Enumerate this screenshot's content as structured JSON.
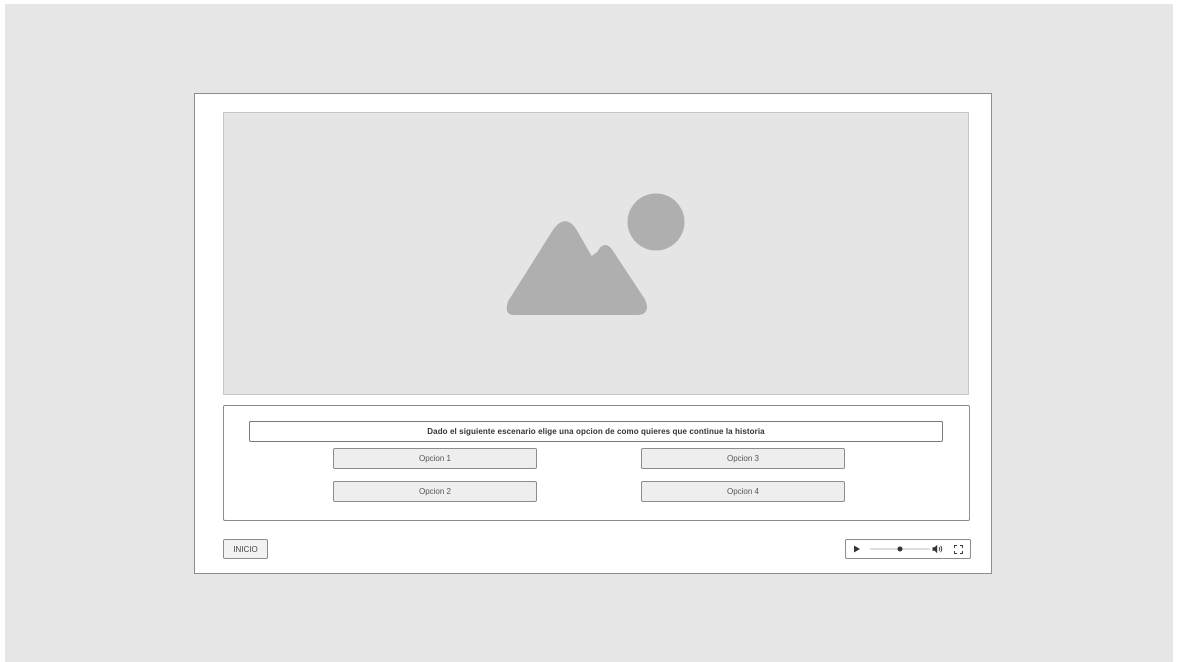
{
  "prompt": {
    "text": "Dado el siguiente escenario elige una opcion de como quieres que continue la historia"
  },
  "options": [
    {
      "label": "Opcion 1"
    },
    {
      "label": "Opcion 2"
    },
    {
      "label": "Opcion 3"
    },
    {
      "label": "Opcion 4"
    }
  ],
  "footer": {
    "start_label": "INICIO"
  },
  "player": {
    "progress": 0.5,
    "icons": {
      "play": "play-icon",
      "seek": "seek-slider",
      "volume": "volume-icon",
      "fullscreen": "fullscreen-icon"
    }
  },
  "image": {
    "icon": "image-placeholder-icon"
  },
  "colors": {
    "backdrop": "#e6e6e6",
    "placeholder_fill": "#e5e5e5",
    "placeholder_glyph": "#afafaf",
    "border": "#8c8c8c",
    "option_fill": "#eeeeee"
  }
}
